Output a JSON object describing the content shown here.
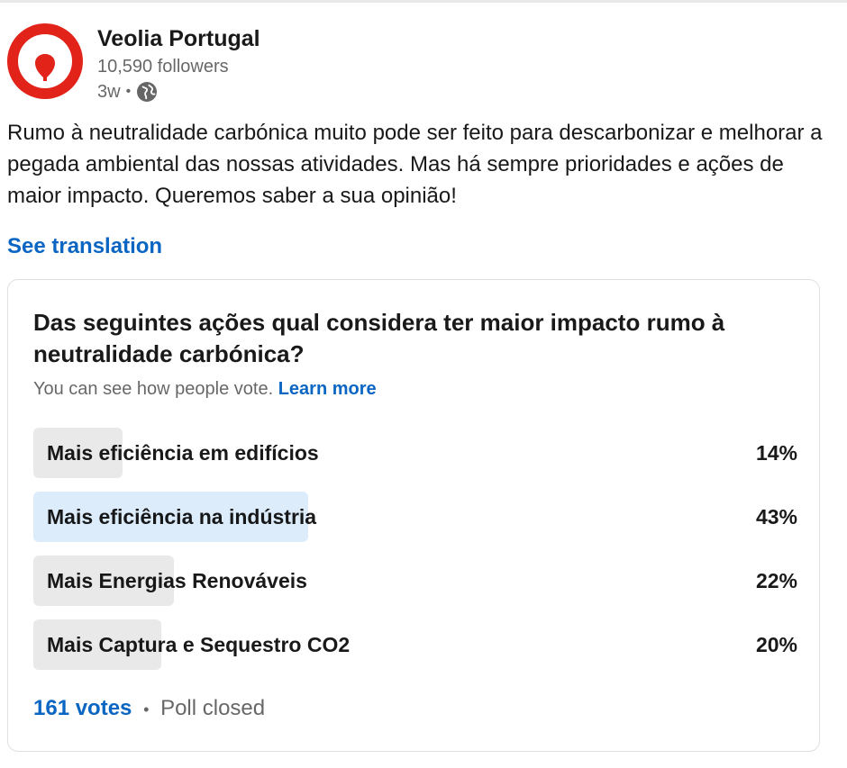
{
  "post": {
    "author": "Veolia Portugal",
    "followers": "10,590 followers",
    "time": "3w",
    "visibility_icon": "globe-icon",
    "text": "Rumo à neutralidade carbónica muito pode ser feito para descarbonizar e melhorar a pegada ambiental das nossas atividades. Mas há sempre prioridades e ações de maior impacto. Queremos saber a sua opinião!",
    "see_translation": "See translation"
  },
  "poll": {
    "question": "Das seguintes ações qual considera ter maior impacto rumo à neutralidade carbónica?",
    "note": "You can see how people vote.",
    "learn_more": "Learn more",
    "options": [
      {
        "label": "Mais eficiência em edifícios",
        "pct": "14%",
        "value": 14
      },
      {
        "label": "Mais eficiência na indústria",
        "pct": "43%",
        "value": 43
      },
      {
        "label": "Mais Energias Renováveis",
        "pct": "22%",
        "value": 22
      },
      {
        "label": "Mais Captura e Sequestro CO2",
        "pct": "20%",
        "value": 20
      }
    ],
    "votes": "161 votes",
    "status": "Poll closed"
  },
  "colors": {
    "brand_red": "#e2231a",
    "link_blue": "#0a66c2",
    "top_option_fill": "#ddecfb",
    "option_fill": "#e9e9e9"
  }
}
